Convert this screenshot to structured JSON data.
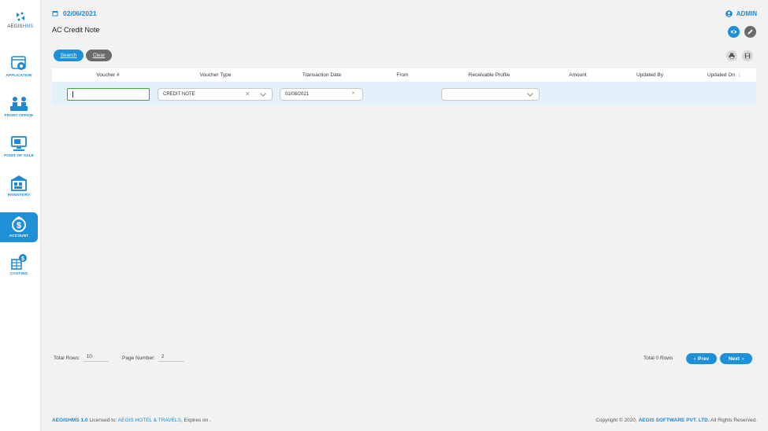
{
  "app": {
    "logo_prefix": "AEGIS",
    "logo_suffix": "HMS"
  },
  "sidebar": {
    "items": [
      {
        "label": "APPLICATION",
        "icon": "application-gear-icon"
      },
      {
        "label": "FRONT OFFICE",
        "icon": "front-office-desk-icon"
      },
      {
        "label": "POINT OF SALE",
        "icon": "point-of-sale-monitor-icon"
      },
      {
        "label": "INVENTORY",
        "icon": "inventory-warehouse-icon"
      },
      {
        "label": "ACCOUNT",
        "icon": "account-dollar-bag-icon"
      },
      {
        "label": "COSTING",
        "icon": "costing-calculator-icon"
      }
    ],
    "active": "ACCOUNT"
  },
  "header": {
    "date": "02/06/2021",
    "user": "ADMIN",
    "title": "AC Credit Note"
  },
  "toolbar": {
    "search_label": "Search",
    "clear_label": "Clear"
  },
  "table": {
    "columns": [
      "Voucher #",
      "Voucher Type",
      "Transaction Date",
      "From",
      "Receivable Profile",
      "Amount",
      "Updated By",
      "Updated On"
    ],
    "sort_indicator": "↕",
    "filters": {
      "voucher_no": "",
      "voucher_type": "CREDIT NOTE",
      "transaction_date": "01/08/2021",
      "receivable_profile": ""
    }
  },
  "pagination": {
    "total_rows_label": "Total Rows:",
    "total_rows_value": "10",
    "page_number_label": "Page Number:",
    "page_number_value": "2",
    "total_count": "Total 0 Rows",
    "prev_label": "Prev",
    "next_label": "Next"
  },
  "footer": {
    "version": "AEGISHMS 1.0",
    "licensed_to_label": " Licensed to: ",
    "licensee": "AEGIS HOTEL & TRAVELS",
    "expires": ", Expires on .",
    "copyright": "Copyright © 2020, ",
    "company": "AEGIS SOFTWARE PVT. LTD.",
    "rights": " All Rights Reserved."
  },
  "colors": {
    "accent": "#1e90d8",
    "filter_row": "#e3f1fb",
    "focus_border": "#3aa835",
    "clear_button": "#6b6b6b"
  }
}
